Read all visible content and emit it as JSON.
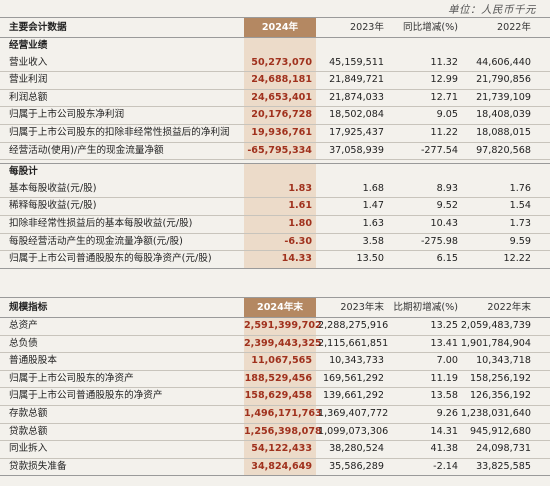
{
  "unit_label": "单位：人民币千元",
  "table1": {
    "headers": [
      "主要会计数据",
      "2024年",
      "2023年",
      "同比增减(%)",
      "2022年"
    ],
    "sections": [
      {
        "title": "经营业绩",
        "rows": [
          [
            "营业收入",
            "50,273,070",
            "45,159,511",
            "11.32",
            "44,606,440"
          ],
          [
            "营业利润",
            "24,688,181",
            "21,849,721",
            "12.99",
            "21,790,856"
          ],
          [
            "利润总额",
            "24,653,401",
            "21,874,033",
            "12.71",
            "21,739,109"
          ],
          [
            "归属于上市公司股东净利润",
            "20,176,728",
            "18,502,084",
            "9.05",
            "18,408,039"
          ],
          [
            "归属于上市公司股东的扣除非经常性损益后的净利润",
            "19,936,761",
            "17,925,437",
            "11.22",
            "18,088,015"
          ],
          [
            "经营活动(使用)/产生的现金流量净额",
            "-65,795,334",
            "37,058,939",
            "-277.54",
            "97,820,568"
          ]
        ]
      },
      {
        "title": "每股计",
        "rows": [
          [
            "基本每股收益(元/股)",
            "1.83",
            "1.68",
            "8.93",
            "1.76"
          ],
          [
            "稀释每股收益(元/股)",
            "1.61",
            "1.47",
            "9.52",
            "1.54"
          ],
          [
            "扣除非经常性损益后的基本每股收益(元/股)",
            "1.80",
            "1.63",
            "10.43",
            "1.73"
          ],
          [
            "每股经营活动产生的现金流量净额(元/股)",
            "-6.30",
            "3.58",
            "-275.98",
            "9.59"
          ],
          [
            "归属于上市公司普通股股东的每股净资产(元/股)",
            "14.33",
            "13.50",
            "6.15",
            "12.22"
          ]
        ]
      }
    ]
  },
  "table2": {
    "headers": [
      "规模指标",
      "2024年末",
      "2023年末",
      "比期初增减(%)",
      "2022年末"
    ],
    "rows": [
      [
        "总资产",
        "2,591,399,702",
        "2,288,275,916",
        "13.25",
        "2,059,483,739"
      ],
      [
        "总负债",
        "2,399,443,325",
        "2,115,661,851",
        "13.41",
        "1,901,784,904"
      ],
      [
        "普通股股本",
        "11,067,565",
        "10,343,733",
        "7.00",
        "10,343,718"
      ],
      [
        "归属于上市公司股东的净资产",
        "188,529,456",
        "169,561,292",
        "11.19",
        "158,256,192"
      ],
      [
        "归属于上市公司普通股股东的净资产",
        "158,629,458",
        "139,661,292",
        "13.58",
        "126,356,192"
      ],
      [
        "存款总额",
        "1,496,171,763",
        "1,369,407,772",
        "9.26",
        "1,238,031,640"
      ],
      [
        "贷款总额",
        "1,256,398,078",
        "1,099,073,306",
        "14.31",
        "945,912,680"
      ],
      [
        "同业拆入",
        "54,122,433",
        "38,280,524",
        "41.38",
        "24,098,731"
      ],
      [
        "贷款损失准备",
        "34,824,649",
        "35,586,289",
        "-2.14",
        "33,825,585"
      ]
    ]
  }
}
